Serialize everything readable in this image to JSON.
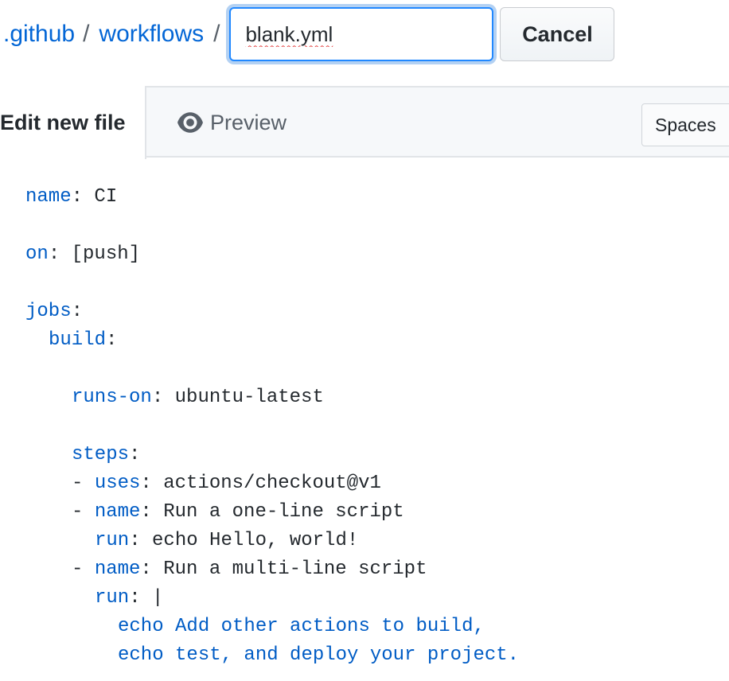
{
  "breadcrumb": {
    "dir1": ".github",
    "dir2": "workflows",
    "separator": "/"
  },
  "filename_input": {
    "value": "blank.yml"
  },
  "cancel_button": "Cancel",
  "tabs": {
    "edit": "Edit new file",
    "preview": "Preview"
  },
  "indent_mode": "Spaces",
  "code": {
    "l1_key": "name",
    "l1_val": ": CI",
    "l2_key": "on",
    "l2_val": ": [push]",
    "l3_key": "jobs",
    "l3_val": ":",
    "l4_key": "build",
    "l4_val": ":",
    "l5_key": "runs-on",
    "l5_val": ": ubuntu-latest",
    "l6_key": "steps",
    "l6_val": ":",
    "l7_dash": "- ",
    "l7_key": "uses",
    "l7_val": ": actions/checkout@v1",
    "l8_dash": "- ",
    "l8_key": "name",
    "l8_val": ": Run a one-line script",
    "l9_key": "run",
    "l9_val": ": echo Hello, world!",
    "l10_dash": "- ",
    "l10_key": "name",
    "l10_val": ": Run a multi-line script",
    "l11_key": "run",
    "l11_val": ": |",
    "l12": "echo Add other actions to build,",
    "l13": "echo test, and deploy your project."
  }
}
